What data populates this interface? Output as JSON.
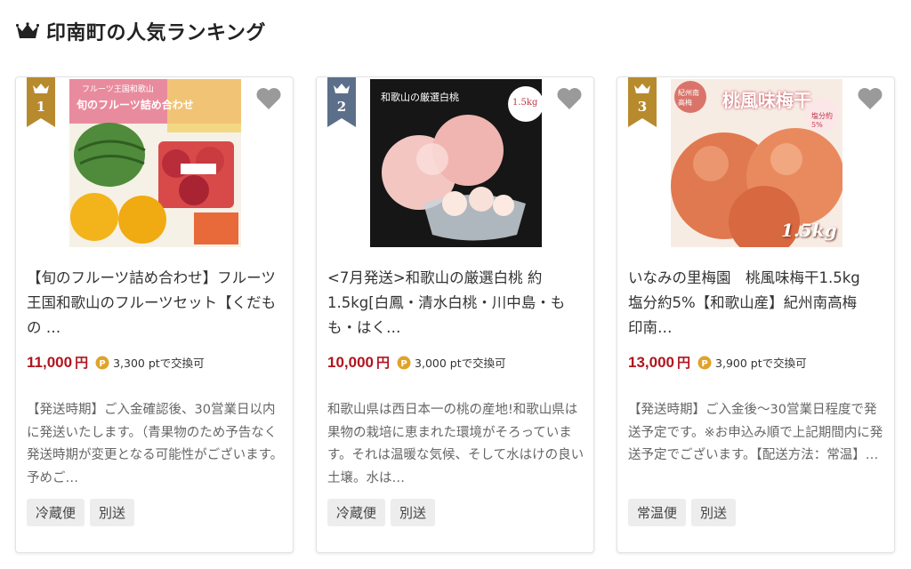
{
  "header": {
    "title": "印南町の人気ランキング",
    "icon": "crown-icon"
  },
  "colors": {
    "rank_1": "#b88a2e",
    "rank_2": "#5c6f8a",
    "rank_3": "#b88a2e",
    "price": "#b0151f",
    "point": "#e0a32a",
    "heart": "#9a9a9a"
  },
  "products": [
    {
      "rank": "1",
      "image_text": [
        "フルーツ王国和歌山",
        "旬のフルーツ詰め合わせ"
      ],
      "name": "【旬のフルーツ詰め合わせ】フルーツ王国和歌山のフルーツセット【くだもの …",
      "price": "11,000",
      "yen": "円",
      "points": "3,300 ptで交換可",
      "description": "【発送時期】ご入金確認後、30営業日以内に発送いたします。（青果物のため予告なく発送時期が変更となる可能性がございます。予めご…",
      "tags": [
        "冷蔵便",
        "別送"
      ]
    },
    {
      "rank": "2",
      "image_text": [
        "和歌山の厳選白桃",
        "1.5kg"
      ],
      "name": "<7月発送>和歌山の厳選白桃 約1.5kg[白鳳・清水白桃・川中島・もも・はく…",
      "price": "10,000",
      "yen": "円",
      "points": "3,000 ptで交換可",
      "description": "和歌山県は西日本一の桃の産地!和歌山県は果物の栽培に恵まれた環境がそろっています。それは温暖な気候、そして水はけの良い土壌。水は…",
      "tags": [
        "冷蔵便",
        "別送"
      ]
    },
    {
      "rank": "3",
      "image_text": [
        "紀州南高梅",
        "桃風味梅干",
        "塩分約5%",
        "1.5kg"
      ],
      "name": "いなみの里梅園　桃風味梅干1.5kg　塩分約5%【和歌山産】紀州南高梅　印南…",
      "price": "13,000",
      "yen": "円",
      "points": "3,900 ptで交換可",
      "description": "【発送時期】ご入金後～30営業日程度で発送予定です。※お申込み順で上記期間内に発送予定でございます。【配送方法：常温】…",
      "tags": [
        "常温便",
        "別送"
      ]
    }
  ]
}
